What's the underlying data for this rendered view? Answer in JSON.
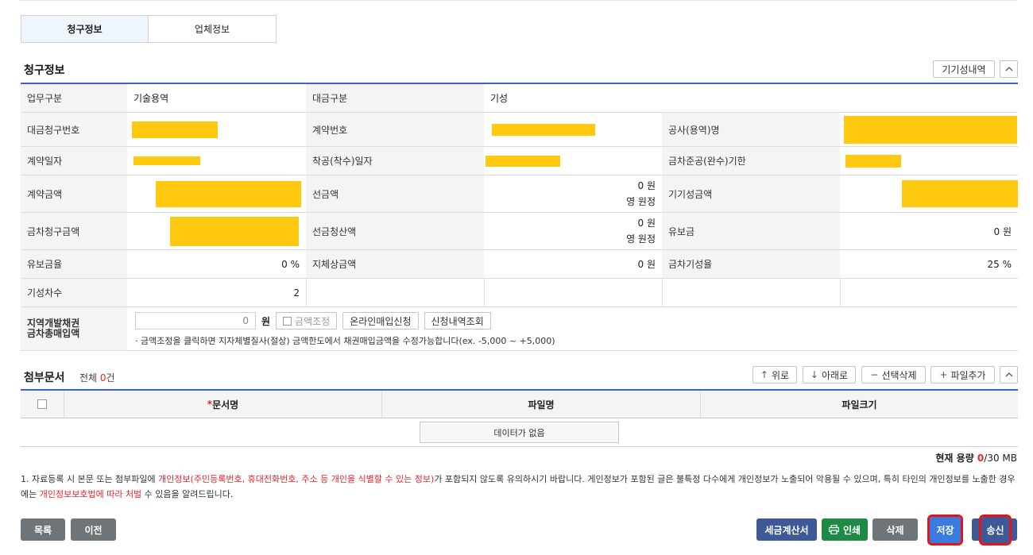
{
  "tabs": [
    "청구정보",
    "업체정보"
  ],
  "section_title": "청구정보",
  "prev_history_btn": "기기성내역",
  "collapse_icon": "^",
  "info": {
    "r1": {
      "l1": "업무구분",
      "v1": "기술용역",
      "l2": "대금구분",
      "v2": "기성"
    },
    "r2": {
      "l1": "대금청구번호",
      "l2": "계약번호",
      "l3": "공사(용역)명"
    },
    "r3": {
      "l1": "계약일자",
      "l2": "착공(착수)일자",
      "l3": "금차준공(완수)기한"
    },
    "r4": {
      "l1": "계약금액",
      "l2": "선금액",
      "v2a": "0 원",
      "v2b": "영 원정",
      "l3": "기기성금액"
    },
    "r5": {
      "l1": "금차청구금액",
      "l2": "선금청산액",
      "v2a": "0 원",
      "v2b": "영 원정",
      "l3": "유보금",
      "v3": "0 원"
    },
    "r6": {
      "l1": "유보금율",
      "v1": "0 %",
      "l2": "지체상금액",
      "v2": "0 원",
      "l3": "금차기성율",
      "v3": "25 %"
    },
    "r7": {
      "l1": "기성차수",
      "v1": "2"
    },
    "r8": {
      "l1a": "지역개발채권",
      "l1b": "금차총매입액",
      "input_value": "0",
      "unit": "원",
      "adjust_btn": "금액조정",
      "online_btn": "온라인매입신청",
      "history_btn": "신청내역조회",
      "note": "· 금액조정을 클릭하면 지자체별질사(절상) 금액한도에서 채권매입금액을 수정가능합니다(ex. -5,000 ~ +5,000)"
    }
  },
  "attachments": {
    "title": "첨부문서",
    "count_prefix": "전체 ",
    "count": "0",
    "count_suffix": "건",
    "btn_up": "위로",
    "btn_down": "아래로",
    "btn_delete": "선택삭제",
    "btn_add": "파일추가",
    "col_doc": "문서명",
    "col_file": "파일명",
    "col_size": "파일크기",
    "no_data": "데이터가 없음",
    "capacity_label": "현재 용량 ",
    "capacity_used": "0",
    "capacity_total": "/30 MB"
  },
  "notice": {
    "p1": "1. 자료등록 시 본문 또는 첨부파일에 ",
    "r1": "개인정보(주민등록번호, 휴대전화번호, 주소 등 개인을 식별할 수 있는 정보)",
    "p2": "가 포함되지 않도록 유의하시기 바랍니다. 게인정보가 포함된 글은 불특정 다수에게 개인정보가 노출되어 악용될 수 있으며, 특히 타인의 개인정보를 노출한 경우에는 ",
    "r2": "개인정보보호법에 따라 처벌",
    "p3": " 수 있음을 알려드립니다."
  },
  "footer": {
    "list": "목록",
    "prev": "이전",
    "tax": "세금계산서",
    "print": "인쇄",
    "delete": "삭제",
    "save": "저장",
    "send": "송신"
  },
  "colors": {
    "accent": "#3a63c7",
    "highlight": "#ffc90f",
    "red": "#e8262a"
  }
}
